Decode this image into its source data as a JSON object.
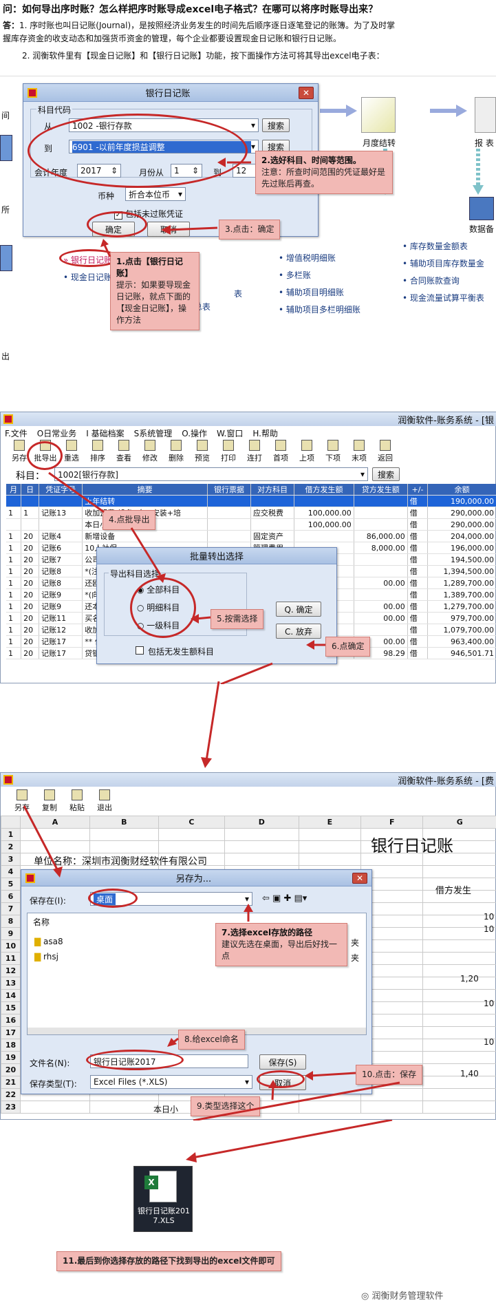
{
  "intro": {
    "question": "问：如何导出序时账？怎么样把序时账导成excel电子格式？在哪可以将序时账导出来？",
    "answer_label": "答：",
    "answer_line1": "1. 序时账也叫日记账(Journal)，是按照经济业务发生的时间先后顺序逐日逐笔登记的账簿。为了及时掌",
    "answer_line2": "握库存资金的收支动态和加强货币资金的管理，每个企业都要设置现金日记账和银行日记账。",
    "step_line": "2. 润衡软件里有【现金日记账】和【银行日记账】功能，按下面操作方法可将其导出excel电子表："
  },
  "shot1": {
    "dialog_title": "银行日记账",
    "group_label": "科目代码",
    "from_label": "从",
    "from_value": "1002      -银行存款",
    "to_label": "到",
    "to_value": "6901      -以前年度损益调整",
    "search_button": "搜索",
    "year_label": "会计年度",
    "year_value": "2017",
    "month_from_label": "月份从",
    "month_from_value": "1",
    "month_to_label": "到",
    "month_to_value": "12",
    "currency_label": "币种",
    "currency_value": "折合本位币",
    "checkbox_label": "包括未过账凭证",
    "ok_button": "确定",
    "cancel_button": "取消",
    "bg_left_items": [
      "间",
      "所",
      "出"
    ],
    "month_close": "月度结转",
    "report": "报 表",
    "data": "数据备",
    "nav_items": [
      "银行日记账",
      "现金日记账",
      "凭证汇总表",
      "增值税明细账",
      "多栏账",
      "辅助项目明细账",
      "辅助项目多栏明细账",
      "库存数量金额表",
      "辅助项目库存数量金",
      "合同账款查询",
      "现金流量试算平衡表"
    ],
    "callout1_title": "1.点击【银行日记账】",
    "callout1_body": "提示：如果要导现金日记账，就点下面的【现金日记账】，操作方法",
    "callout2_title": "2.选好科目、时间等范围。",
    "callout2_body": "注意：所查时间范围的凭证最好是先过账后再查。",
    "callout3": "3.点击：确定",
    "table_fragment": "表"
  },
  "shot2": {
    "title": "润衡软件-账务系统 - [银",
    "menus": [
      "F.文件",
      "O日常业务",
      "I 基础档案",
      "S系统管理",
      "O.操作",
      "W.窗口",
      "H.帮助"
    ],
    "toolbar": [
      "另存",
      "批导出",
      "重选",
      "排序",
      "查看",
      "修改",
      "删除",
      "预览",
      "打印",
      "连打",
      "首项",
      "上项",
      "下项",
      "末项",
      "返回"
    ],
    "subject_label": "科目：",
    "subject_value": "1002[银行存款]",
    "search_button": "搜索",
    "headers": [
      "月",
      "日",
      "凭证字号",
      "摘要",
      "银行票据",
      "对方科目",
      "借方发生额",
      "贷方发生额",
      "+/-",
      "余额"
    ],
    "rows": [
      [
        "",
        "",
        "",
        "上年结转",
        "",
        "",
        "",
        "",
        "借",
        "190,000.00"
      ],
      [
        "1",
        "1",
        "记账13",
        "收加盟费(设备1台+安装+培",
        "",
        "应交税费",
        "100,000.00",
        "",
        "借",
        "290,000.00"
      ],
      [
        "",
        "",
        "",
        "本日小计",
        "",
        "",
        "100,000.00",
        "",
        "借",
        "290,000.00"
      ],
      [
        "1",
        "20",
        "记账4",
        "新增设备",
        "",
        "固定资产",
        "",
        "86,000.00",
        "借",
        "204,000.00"
      ],
      [
        "1",
        "20",
        "记账6",
        "10人社保",
        "",
        "管理费用",
        "",
        "8,000.00",
        "借",
        "196,000.00"
      ],
      [
        "1",
        "20",
        "记账7",
        "公司经营账",
        "",
        "",
        "",
        "",
        "借",
        "194,500.00"
      ],
      [
        "1",
        "20",
        "记账8",
        "*(注)",
        "",
        "",
        "",
        "",
        "借",
        "1,394,500.00"
      ],
      [
        "1",
        "20",
        "记账8",
        "还欧款",
        "",
        "",
        "",
        "00.00",
        "借",
        "1,289,700.00"
      ],
      [
        "1",
        "20",
        "记账9",
        "*(向",
        "",
        "",
        "",
        "",
        "借",
        "1,389,700.00"
      ],
      [
        "1",
        "20",
        "记账9",
        "还本付",
        "",
        "",
        "",
        "00.00",
        "借",
        "1,279,700.00"
      ],
      [
        "1",
        "20",
        "记账11",
        "买名画",
        "",
        "",
        "",
        "00.00",
        "借",
        "979,700.00"
      ],
      [
        "1",
        "20",
        "记账12",
        "收加盟",
        "",
        "",
        "",
        "",
        "借",
        "1,079,700.00"
      ],
      [
        "1",
        "20",
        "记账17",
        "** 付款",
        "",
        "",
        "",
        "00.00",
        "借",
        "963,400.00"
      ],
      [
        "1",
        "20",
        "记账17",
        "贷银行",
        "",
        "",
        "",
        "98.29",
        "借",
        "946,501.71"
      ]
    ],
    "batch_title": "批量转出选择",
    "batch_group": "导出科目选择",
    "batch_options": [
      "全部科目",
      "明细科目",
      "一级科目"
    ],
    "batch_ok": "Q. 确定",
    "batch_cancel": "C. 放弃",
    "batch_checkbox": "包括无发生额科目",
    "callout4": "4.点批导出",
    "callout5": "5.按需选择",
    "callout6": "6.点确定"
  },
  "shot3": {
    "title": "润衡软件-账务系统 - [费",
    "toolbar": [
      "另存",
      "复制",
      "粘贴",
      "退出"
    ],
    "columns": [
      "A",
      "B",
      "C",
      "D",
      "E",
      "F",
      "G"
    ],
    "sheet_title": "银行日记账",
    "unit_name": "单位名称：深圳市润衡财经软件有限公司",
    "debit_header": "借方发生",
    "right_values": [
      "10",
      "10",
      "1,20",
      "10",
      "10",
      "1,40"
    ],
    "today_subtotal": "本日小",
    "saveas_title": "另存为...",
    "save_in_label": "保存在(I):",
    "save_in_value": "桌面",
    "name_header": "名称",
    "folders": [
      "asa8",
      "rhsj"
    ],
    "filename_label": "文件名(N):",
    "filename_value": "银行日记账2017",
    "filetype_label": "保存类型(T):",
    "filetype_value": "Excel Files (*.XLS)",
    "save_button": "保存(S)",
    "cancel_button": "取消",
    "right_tag": "夹",
    "callout7_title": "7.选择excel存放的路径",
    "callout7_body": "建议先选在桌面，导出后好找一点",
    "callout8": "8.给excel命名",
    "callout9": "9.类型选择这个",
    "callout10": "10.点击：保存"
  },
  "shot4": {
    "file_label": "银行日记账2017.XLS",
    "callout11": "11.最后到你选择存放的路径下找到导出的excel文件即可",
    "watermark": "润衡财务管理软件"
  }
}
